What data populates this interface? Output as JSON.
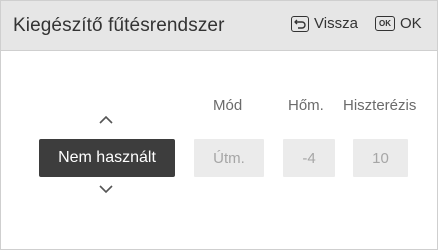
{
  "header": {
    "title": "Kiegészítő fűtésrendszer",
    "back_label": "Vissza",
    "back_icon": "back-arrow-icon",
    "ok_icon_text": "OK",
    "ok_label": "OK"
  },
  "columns": {
    "mode_label": "Mód",
    "temp_label": "Hőm.",
    "hysteresis_label": "Hiszterézis"
  },
  "selector": {
    "value": "Nem használt",
    "up_icon": "chevron-up-icon",
    "down_icon": "chevron-down-icon"
  },
  "values": {
    "mode": "Útm.",
    "temp": "-4",
    "hysteresis": "10"
  },
  "colors": {
    "header_bg": "#e6e6e6",
    "selector_bg": "#3d3d3d",
    "value_box_bg": "#ebebeb",
    "disabled_text": "#a6a6a6"
  }
}
